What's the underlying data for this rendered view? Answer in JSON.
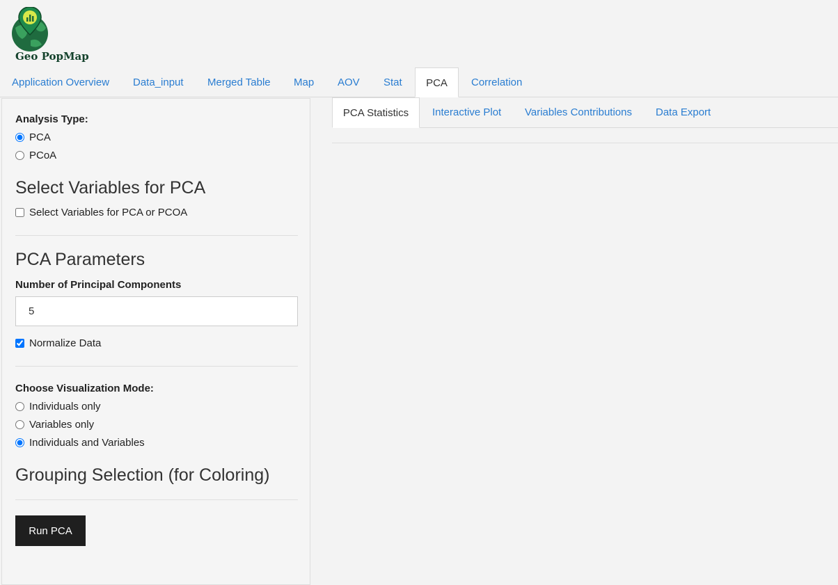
{
  "app": {
    "logo_text": "Geo PopMap",
    "colors": {
      "brand": "#14422c",
      "link": "#2a7dd1",
      "button": "#1f1f1f"
    }
  },
  "main_tabs": [
    {
      "label": "Application Overview",
      "active": false
    },
    {
      "label": "Data_input",
      "active": false
    },
    {
      "label": "Merged Table",
      "active": false
    },
    {
      "label": "Map",
      "active": false
    },
    {
      "label": "AOV",
      "active": false
    },
    {
      "label": "Stat",
      "active": false
    },
    {
      "label": "PCA",
      "active": true
    },
    {
      "label": "Correlation",
      "active": false
    }
  ],
  "sidebar": {
    "analysis_type": {
      "label": "Analysis Type:",
      "options": [
        {
          "label": "PCA",
          "selected": true
        },
        {
          "label": "PCoA",
          "selected": false
        }
      ]
    },
    "select_vars": {
      "heading": "Select Variables for PCA",
      "checkbox_label": "Select Variables for PCA or PCOA",
      "checked": false
    },
    "params": {
      "heading": "PCA Parameters",
      "num_components_label": "Number of Principal Components",
      "num_components_value": "5",
      "normalize_label": "Normalize Data",
      "normalize_checked": true
    },
    "viz_mode": {
      "label": "Choose Visualization Mode:",
      "options": [
        {
          "label": "Individuals only",
          "selected": false
        },
        {
          "label": "Variables only",
          "selected": false
        },
        {
          "label": "Individuals and Variables",
          "selected": true
        }
      ]
    },
    "grouping": {
      "heading": "Grouping Selection (for Coloring)"
    },
    "run_button": "Run PCA"
  },
  "sub_tabs": [
    {
      "label": "PCA Statistics",
      "active": true
    },
    {
      "label": "Interactive Plot",
      "active": false
    },
    {
      "label": "Variables Contributions",
      "active": false
    },
    {
      "label": "Data Export",
      "active": false
    }
  ]
}
